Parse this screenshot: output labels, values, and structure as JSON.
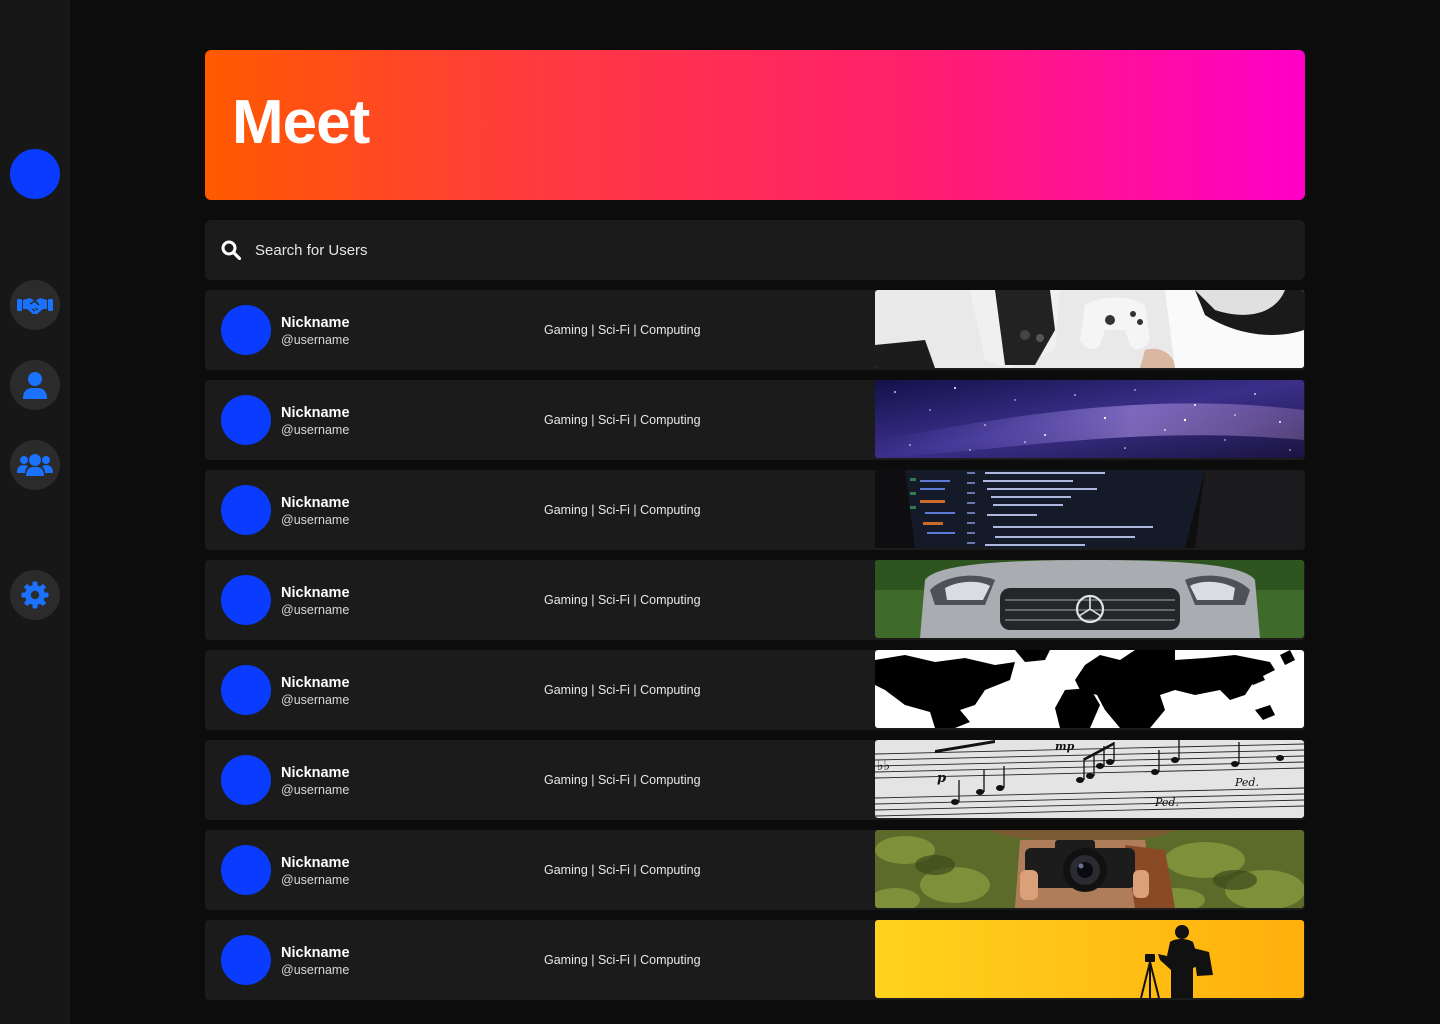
{
  "sidebar": {
    "items": [
      {
        "icon": "handshake-icon",
        "color": "#1a72ff"
      },
      {
        "icon": "user-icon",
        "color": "#1a72ff"
      },
      {
        "icon": "users-icon",
        "color": "#1a72ff"
      },
      {
        "icon": "gear-icon",
        "color": "#1a72ff"
      }
    ],
    "accent": "#0a3cff"
  },
  "header": {
    "title": "Meet",
    "gradient": [
      "#ff5a00",
      "#ff1f6e",
      "#ff00c8"
    ]
  },
  "search": {
    "placeholder": "Search for Users"
  },
  "users": [
    {
      "nickname": "Nickname",
      "username": "@username",
      "interests": "Gaming | Sci-Fi | Computing",
      "banner": "game-controllers"
    },
    {
      "nickname": "Nickname",
      "username": "@username",
      "interests": "Gaming | Sci-Fi | Computing",
      "banner": "starry-sky"
    },
    {
      "nickname": "Nickname",
      "username": "@username",
      "interests": "Gaming | Sci-Fi | Computing",
      "banner": "code-screen"
    },
    {
      "nickname": "Nickname",
      "username": "@username",
      "interests": "Gaming | Sci-Fi | Computing",
      "banner": "silver-car"
    },
    {
      "nickname": "Nickname",
      "username": "@username",
      "interests": "Gaming | Sci-Fi | Computing",
      "banner": "world-map"
    },
    {
      "nickname": "Nickname",
      "username": "@username",
      "interests": "Gaming | Sci-Fi | Computing",
      "banner": "sheet-music"
    },
    {
      "nickname": "Nickname",
      "username": "@username",
      "interests": "Gaming | Sci-Fi | Computing",
      "banner": "photographer"
    },
    {
      "nickname": "Nickname",
      "username": "@username",
      "interests": "Gaming | Sci-Fi | Computing",
      "banner": "silhouette-yellow"
    }
  ]
}
